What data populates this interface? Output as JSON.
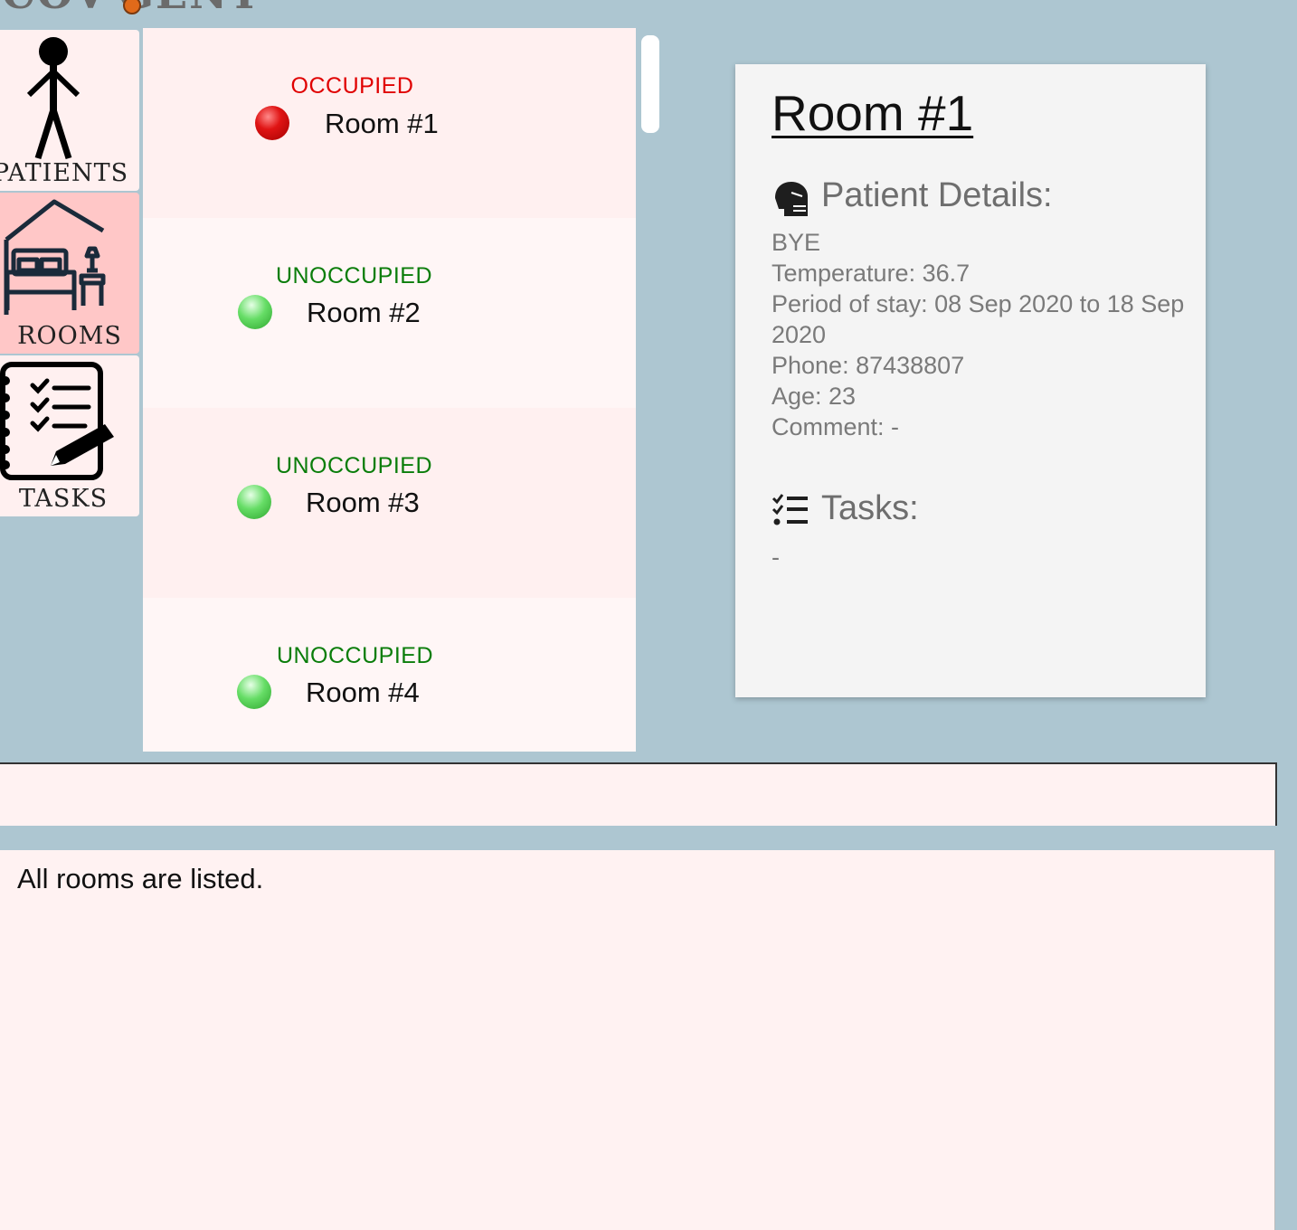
{
  "app": {
    "logo_text": "COV GENT"
  },
  "sidebar": {
    "items": [
      {
        "label": "PATIENTS",
        "active": false,
        "icon": "stick-figure-icon"
      },
      {
        "label": "ROOMS",
        "active": true,
        "icon": "bed-house-icon"
      },
      {
        "label": "TASKS",
        "active": false,
        "icon": "checklist-notebook-icon"
      }
    ]
  },
  "rooms": [
    {
      "status": "OCCUPIED",
      "name": "Room #1",
      "status_color": "#e00000"
    },
    {
      "status": "UNOCCUPIED",
      "name": "Room #2",
      "status_color": "#0a7d0a"
    },
    {
      "status": "UNOCCUPIED",
      "name": "Room #3",
      "status_color": "#0a7d0a"
    },
    {
      "status": "UNOCCUPIED",
      "name": "Room #4",
      "status_color": "#0a7d0a"
    }
  ],
  "details": {
    "title": "Room #1",
    "patient_heading": "Patient Details:",
    "patient_name": "BYE",
    "temperature": "Temperature: 36.7",
    "period_line1": "Period of stay: 08 Sep 2020 to 18 Sep",
    "period_line2": "2020",
    "phone": "Phone: 87438807",
    "age": "Age: 23",
    "comment": "Comment: -",
    "tasks_heading": "Tasks:",
    "tasks_value": "-"
  },
  "command": {
    "value": ""
  },
  "result": {
    "message": "All rooms are listed."
  },
  "colors": {
    "background": "#adc6d1",
    "panel_pink": "#fff2f2",
    "active_nav": "#ffc7c7",
    "occupied": "#e00000",
    "unoccupied": "#0a7d0a"
  }
}
